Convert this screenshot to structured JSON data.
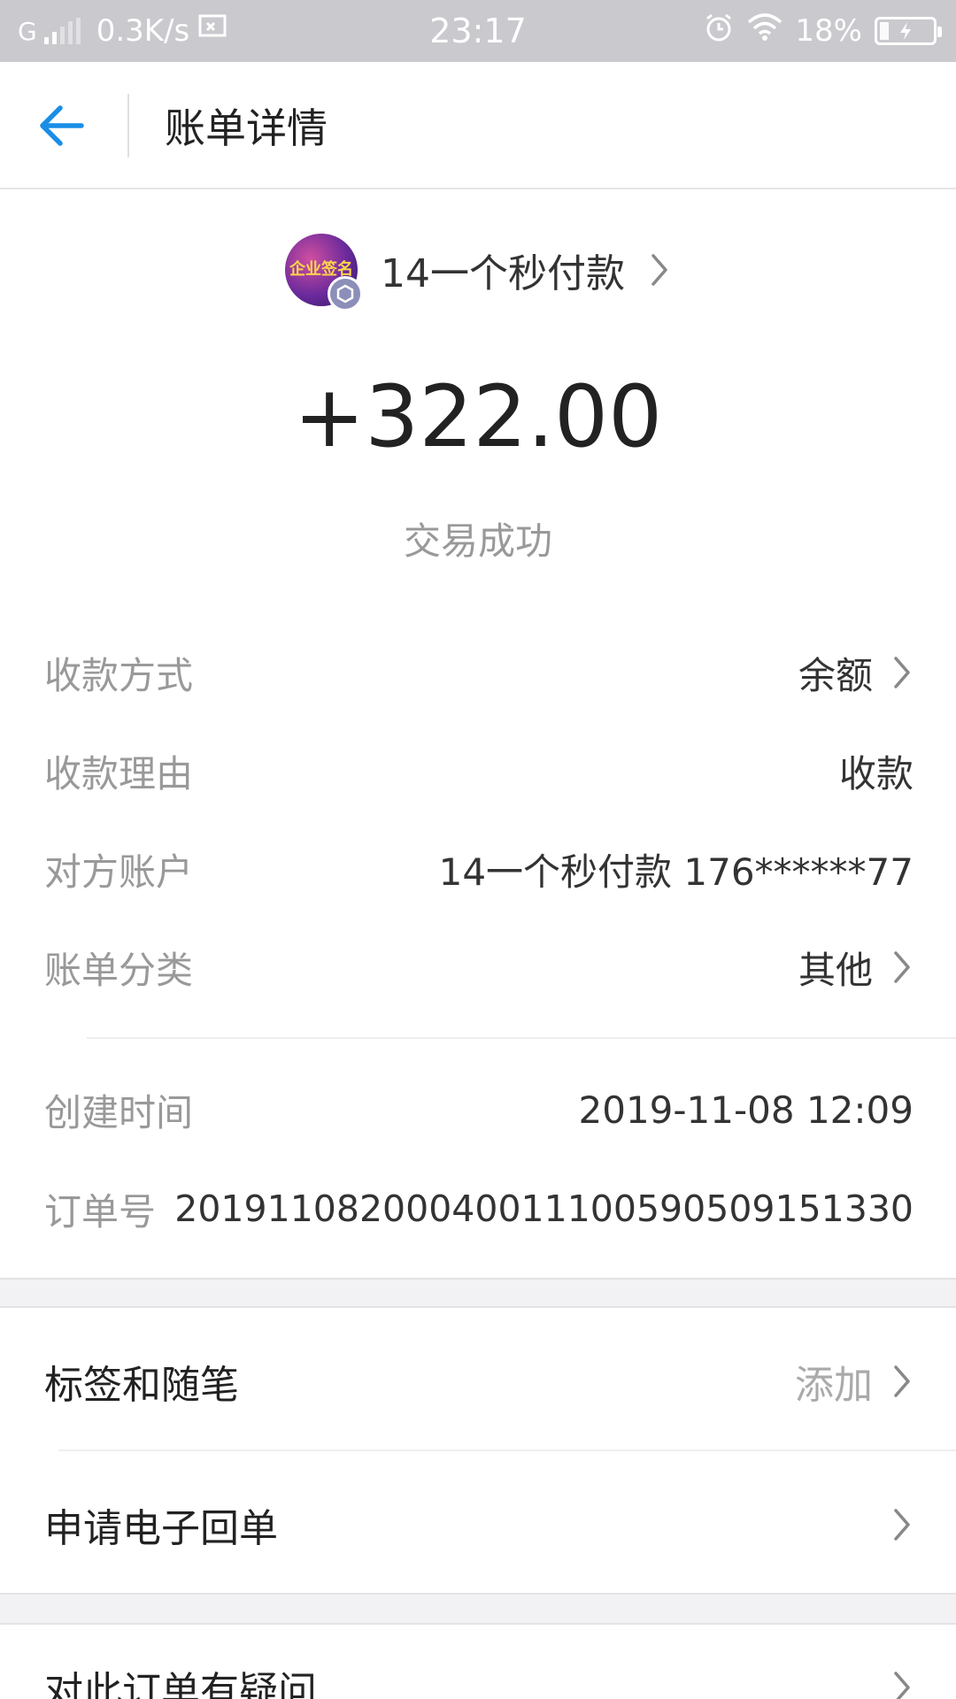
{
  "status_bar": {
    "network": "G",
    "speed": "0.3K/s",
    "time": "23:17",
    "battery_text": "18%",
    "battery_level": 0.18
  },
  "header": {
    "title": "账单详情"
  },
  "payee": {
    "name": "14一个秒付款",
    "avatar_text": "企业签名"
  },
  "amount": "+322.00",
  "transaction_status": "交易成功",
  "details": [
    {
      "label": "收款方式",
      "value": "余额"
    },
    {
      "label": "收款理由",
      "value": "收款"
    },
    {
      "label": "对方账户",
      "value": "14一个秒付款 176******77"
    },
    {
      "label": "账单分类",
      "value": "其他"
    },
    {
      "label": "创建时间",
      "value": "2019-11-08 12:09"
    },
    {
      "label": "订单号",
      "value": "20191108200040011100590509151330"
    }
  ],
  "actions": {
    "tags_label": "标签和随笔",
    "tags_value": "添加",
    "receipt_label": "申请电子回单",
    "question_label": "对此订单有疑问"
  },
  "colors": {
    "accent": "#1a8ee6",
    "status_bar": "#c9c9ce"
  }
}
